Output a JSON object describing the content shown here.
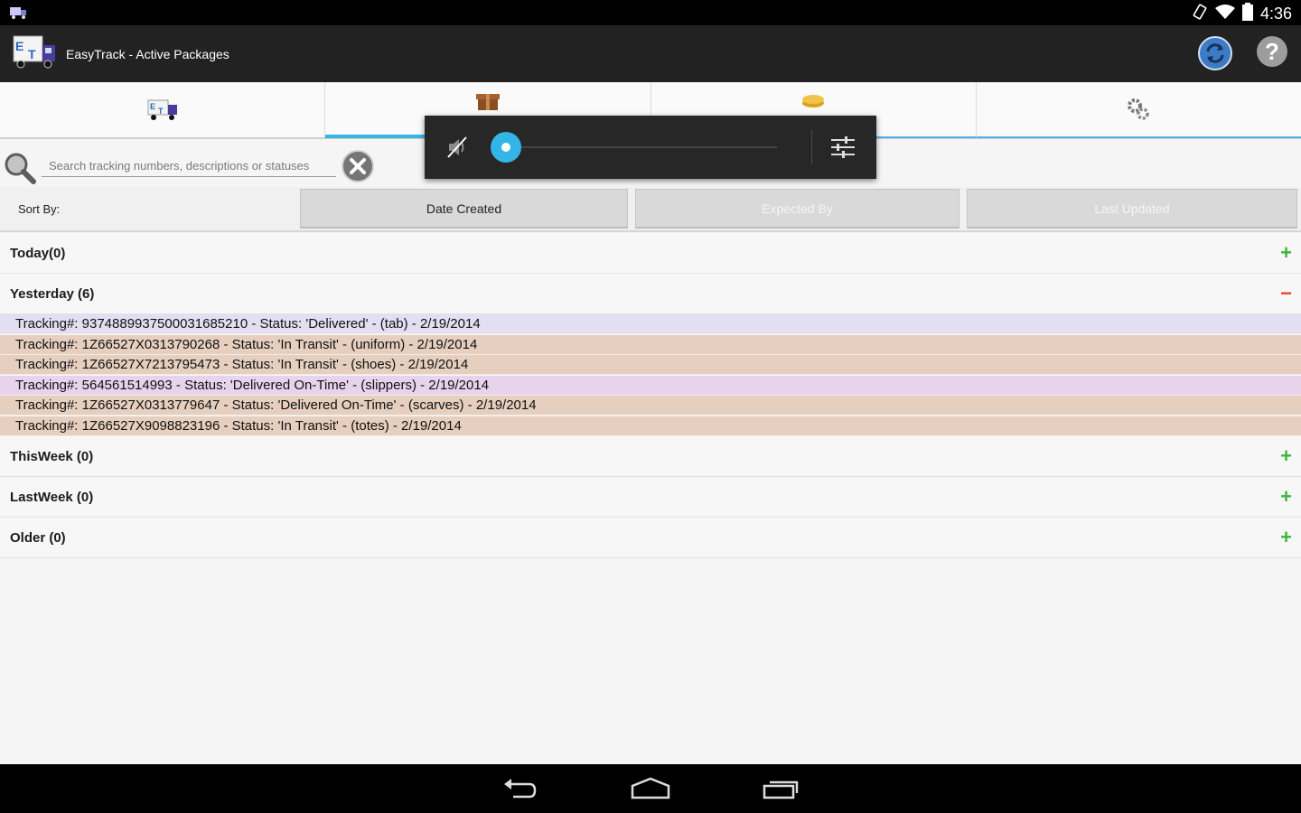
{
  "status_bar": {
    "time": "4:36"
  },
  "action_bar": {
    "title": "EasyTrack - Active Packages"
  },
  "tabs": [
    {
      "name": "tab-active-packages",
      "icon": "truck-icon"
    },
    {
      "name": "tab-packages",
      "icon": "package-icon"
    },
    {
      "name": "tab-coins",
      "icon": "coins-icon"
    },
    {
      "name": "tab-settings",
      "icon": "gears-icon"
    }
  ],
  "search": {
    "placeholder": "Search tracking numbers, descriptions or statuses",
    "value": ""
  },
  "sort": {
    "label": "Sort By:",
    "options": [
      "Date Created",
      "Expected By",
      "Last Updated"
    ],
    "selected": "Date Created"
  },
  "groups": {
    "today": {
      "label": "Today(0)",
      "toggle": "+"
    },
    "yesterday": {
      "label": "Yesterday (6)",
      "toggle": "−"
    },
    "thisweek": {
      "label": "ThisWeek (0)",
      "toggle": "+"
    },
    "lastweek": {
      "label": "LastWeek (0)",
      "toggle": "+"
    },
    "older": {
      "label": "Older (0)",
      "toggle": "+"
    }
  },
  "packages": [
    {
      "text": "Tracking#: 9374889937500031685210 - Status: 'Delivered' - (tab) - 2/19/2014",
      "color": "#e3dff2"
    },
    {
      "text": "Tracking#: 1Z66527X0313790268 - Status: 'In Transit' - (uniform) - 2/19/2014",
      "color": "#e6cfbf"
    },
    {
      "text": "Tracking#: 1Z66527X7213795473 - Status: 'In Transit' - (shoes) - 2/19/2014",
      "color": "#e6cfbf"
    },
    {
      "text": "Tracking#: 564561514993 - Status: 'Delivered On-Time' - (slippers) - 2/19/2014",
      "color": "#e8d3ec"
    },
    {
      "text": "Tracking#: 1Z66527X0313779647 - Status: 'Delivered On-Time' - (scarves) - 2/19/2014",
      "color": "#e6cfbf"
    },
    {
      "text": "Tracking#: 1Z66527X9098823196 - Status: 'In Transit' - (totes) - 2/19/2014",
      "color": "#e6cfbf"
    }
  ],
  "volume": {
    "level": 0,
    "muted": true
  }
}
